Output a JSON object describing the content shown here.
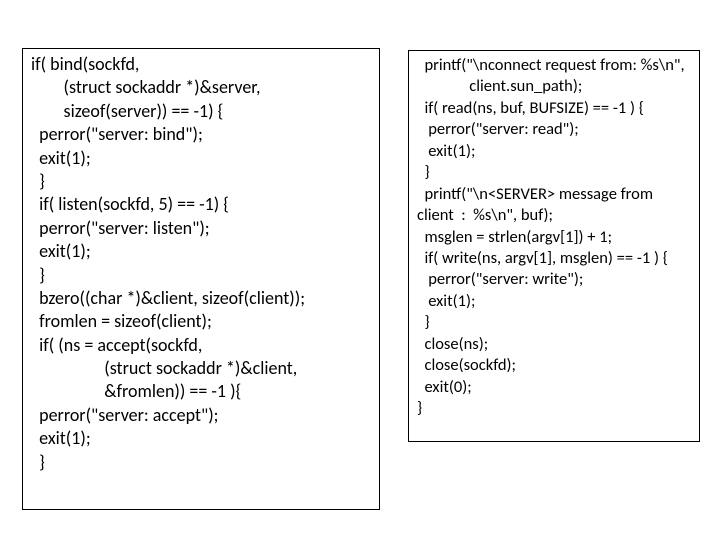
{
  "left_code": "if( bind(sockfd,\n        (struct sockaddr *)&server,\n        sizeof(server)) == -1) {\n  perror(\"server: bind\");\n  exit(1);\n  }\n  if( listen(sockfd, 5) == -1) {\n  perror(\"server: listen\");\n  exit(1);\n  }\n  bzero((char *)&client, sizeof(client));\n  fromlen = sizeof(client);\n  if( (ns = accept(sockfd,\n                  (struct sockaddr *)&client,\n                  &fromlen)) == -1 ){\n  perror(\"server: accept\");\n  exit(1);\n  }",
  "right_code": "  printf(\"\\nconnect request from: %s\\n\",\n              client.sun_path);\n  if( read(ns, buf, BUFSIZE) == -1 ) {\n   perror(\"server: read\");\n   exit(1);\n  }\n  printf(\"\\n<SERVER> message from\nclient  :  %s\\n\", buf);\n  msglen = strlen(argv[1]) + 1;\n  if( write(ns, argv[1], msglen) == -1 ) {\n   perror(\"server: write\");\n   exit(1);\n  }\n  close(ns);\n  close(sockfd);\n  exit(0);\n}"
}
